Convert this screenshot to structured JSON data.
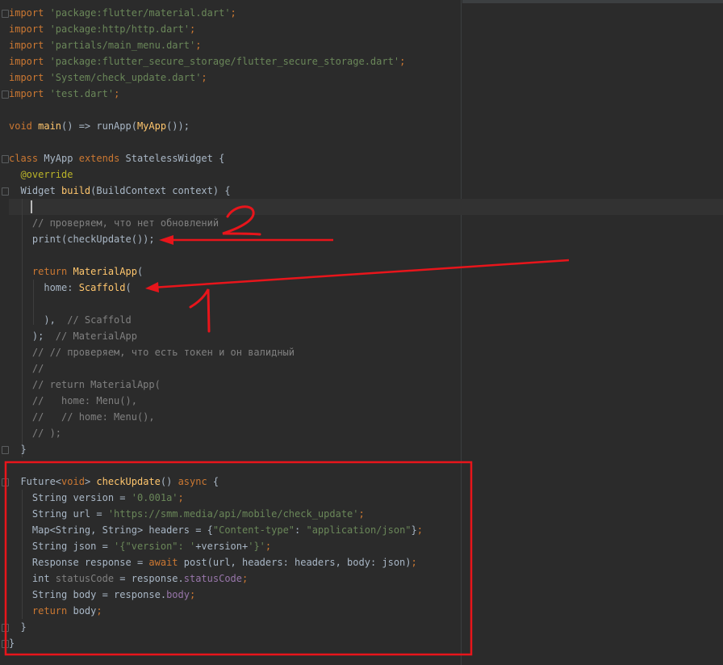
{
  "code_lines": [
    [
      [
        "kw",
        "import "
      ],
      [
        "str",
        "'package:flutter/material.dart'"
      ],
      [
        "kw",
        ";"
      ]
    ],
    [
      [
        "kw",
        "import "
      ],
      [
        "str",
        "'package:http/http.dart'"
      ],
      [
        "kw",
        ";"
      ]
    ],
    [
      [
        "kw",
        "import "
      ],
      [
        "str",
        "'partials/main_menu.dart'"
      ],
      [
        "kw",
        ";"
      ]
    ],
    [
      [
        "kw",
        "import "
      ],
      [
        "str",
        "'package:flutter_secure_storage/flutter_secure_storage.dart'"
      ],
      [
        "kw",
        ";"
      ]
    ],
    [
      [
        "kw",
        "import "
      ],
      [
        "str",
        "'System/check_update.dart'"
      ],
      [
        "kw",
        ";"
      ]
    ],
    [
      [
        "kw",
        "import "
      ],
      [
        "str",
        "'test.dart'"
      ],
      [
        "kw",
        ";"
      ]
    ],
    [],
    [
      [
        "kw",
        "void "
      ],
      [
        "fn",
        "main"
      ],
      [
        "ty",
        "() => runApp("
      ],
      [
        "fn",
        "MyApp"
      ],
      [
        "ty",
        "());"
      ]
    ],
    [],
    [
      [
        "kw",
        "class "
      ],
      [
        "ty",
        "MyApp "
      ],
      [
        "kw",
        "extends "
      ],
      [
        "ty",
        "StatelessWidget {"
      ]
    ],
    [
      [
        "ty",
        "  "
      ],
      [
        "ann",
        "@override"
      ]
    ],
    [
      [
        "ty",
        "  Widget "
      ],
      [
        "fn",
        "build"
      ],
      [
        "ty",
        "(BuildContext context) {"
      ]
    ],
    [],
    [
      [
        "cm",
        "    // проверяем, что нет обновлений"
      ]
    ],
    [
      [
        "ty",
        "    print(checkUpdate());"
      ]
    ],
    [],
    [
      [
        "ty",
        "    "
      ],
      [
        "kw",
        "return "
      ],
      [
        "fn",
        "MaterialApp"
      ],
      [
        "ty",
        "("
      ]
    ],
    [
      [
        "ty",
        "      home: "
      ],
      [
        "fn",
        "Scaffold"
      ],
      [
        "ty",
        "("
      ]
    ],
    [],
    [
      [
        "ty",
        "      ),  "
      ],
      [
        "cm",
        "// Scaffold"
      ]
    ],
    [
      [
        "ty",
        "    );  "
      ],
      [
        "cm",
        "// MaterialApp"
      ]
    ],
    [
      [
        "cm",
        "    // // проверяем, что есть токен и он валидный"
      ]
    ],
    [
      [
        "cm",
        "    //"
      ]
    ],
    [
      [
        "cm",
        "    // return MaterialApp("
      ]
    ],
    [
      [
        "cm",
        "    //   home: Menu(),"
      ]
    ],
    [
      [
        "cm",
        "    //   // home: Menu(),"
      ]
    ],
    [
      [
        "cm",
        "    // );"
      ]
    ],
    [
      [
        "ty",
        "  }"
      ]
    ],
    [],
    [
      [
        "ty",
        "  Future<"
      ],
      [
        "kw",
        "void"
      ],
      [
        "ty",
        "> "
      ],
      [
        "fn",
        "checkUpdate"
      ],
      [
        "ty",
        "() "
      ],
      [
        "kw",
        "async "
      ],
      [
        "ty",
        "{"
      ]
    ],
    [
      [
        "ty",
        "    String version = "
      ],
      [
        "str",
        "'0.001a'"
      ],
      [
        "kw",
        ";"
      ]
    ],
    [
      [
        "ty",
        "    String url = "
      ],
      [
        "str",
        "'https://smm.media/api/mobile/check_update'"
      ],
      [
        "kw",
        ";"
      ]
    ],
    [
      [
        "ty",
        "    Map<String, String> headers = {"
      ],
      [
        "str",
        "\"Content-type\""
      ],
      [
        "ty",
        ": "
      ],
      [
        "str",
        "\"application/json\""
      ],
      [
        "ty",
        "}"
      ],
      [
        "kw",
        ";"
      ]
    ],
    [
      [
        "ty",
        "    String json = "
      ],
      [
        "str",
        "'{\"version\": '"
      ],
      [
        "ty",
        "+version+"
      ],
      [
        "str",
        "'}'"
      ],
      [
        "kw",
        ";"
      ]
    ],
    [
      [
        "ty",
        "    Response response = "
      ],
      [
        "kw",
        "await "
      ],
      [
        "ty",
        "post(url, headers: headers, body: json)"
      ],
      [
        "kw",
        ";"
      ]
    ],
    [
      [
        "ty",
        "    int "
      ],
      [
        "cm",
        "statusCode"
      ],
      [
        "ty",
        " = response."
      ],
      [
        "fld",
        "statusCode"
      ],
      [
        "kw",
        ";"
      ]
    ],
    [
      [
        "ty",
        "    String body = response."
      ],
      [
        "fld",
        "body"
      ],
      [
        "kw",
        ";"
      ]
    ],
    [
      [
        "ty",
        "    "
      ],
      [
        "kw",
        "return "
      ],
      [
        "ty",
        "body"
      ],
      [
        "kw",
        ";"
      ]
    ],
    [
      [
        "ty",
        "  }"
      ]
    ],
    [
      [
        "ty",
        "}"
      ]
    ]
  ],
  "annotations": {
    "label_1": "1",
    "label_2": "2",
    "highlight_color": "#e8151b"
  },
  "colors": {
    "background": "#2b2b2b",
    "keyword": "#cc7832",
    "string": "#6a8759",
    "function": "#ffc66d",
    "comment": "#808080",
    "annotation": "#bbb529",
    "field": "#9876aa",
    "text": "#a9b7c6"
  }
}
